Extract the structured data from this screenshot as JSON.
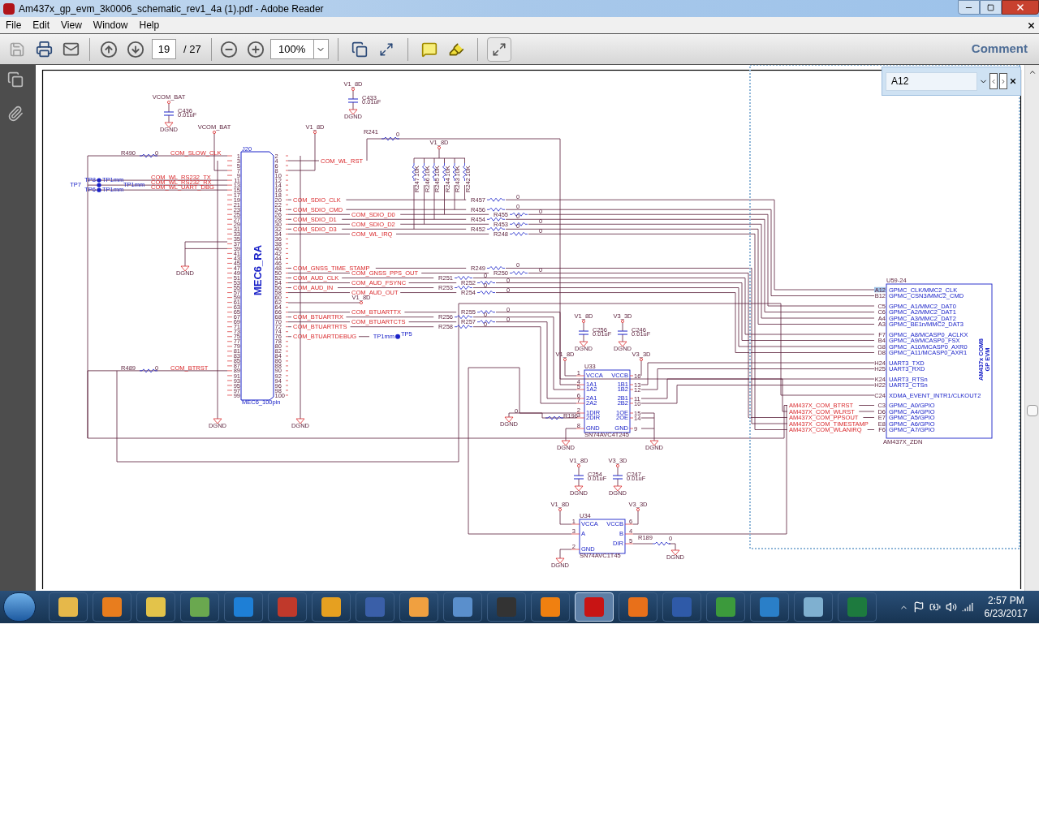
{
  "window": {
    "title": "Am437x_gp_evm_3k0006_schematic_rev1_4a (1).pdf - Adobe Reader"
  },
  "menu": [
    "File",
    "Edit",
    "View",
    "Window",
    "Help"
  ],
  "toolbar": {
    "page": "19",
    "page_total": "/ 27",
    "zoom": "100%",
    "comment": "Comment"
  },
  "find": {
    "value": "A12"
  },
  "schematic": {
    "j20": {
      "ref": "J20",
      "label": "MEC6_RA",
      "part": "MEC6_100pin",
      "left_pins": [
        {
          "num": "1",
          "net": "COM_SLOW_CLK",
          "resistor": "R490",
          "value": "0"
        },
        {
          "num": "3"
        },
        {
          "num": "5"
        },
        {
          "num": "7"
        },
        {
          "num": "9"
        },
        {
          "num": "11",
          "net": "COM_WL_RS232_TX",
          "testpoint": "TP8",
          "tp_type": "TP1mm"
        },
        {
          "num": "13",
          "net": "COM_WL_RS232_RX",
          "testpoint": "TP7",
          "tp_type": "TP1mm"
        },
        {
          "num": "15",
          "net": "COM_WL_UART_DBG",
          "testpoint": "TP6",
          "tp_type": "TP1mm"
        },
        {
          "num": "17"
        },
        {
          "num": "19"
        },
        {
          "num": "21"
        },
        {
          "num": "23"
        },
        {
          "num": "25"
        },
        {
          "num": "27"
        },
        {
          "num": "29"
        },
        {
          "num": "31"
        },
        {
          "num": "33"
        },
        {
          "num": "35"
        },
        {
          "num": "37"
        },
        {
          "num": "39"
        },
        {
          "num": "41"
        },
        {
          "num": "43"
        },
        {
          "num": "45"
        },
        {
          "num": "47"
        },
        {
          "num": "49"
        },
        {
          "num": "51"
        },
        {
          "num": "53"
        },
        {
          "num": "55"
        },
        {
          "num": "57"
        },
        {
          "num": "59"
        },
        {
          "num": "61"
        },
        {
          "num": "63"
        },
        {
          "num": "65"
        },
        {
          "num": "67"
        },
        {
          "num": "69"
        },
        {
          "num": "71"
        },
        {
          "num": "73"
        },
        {
          "num": "75"
        },
        {
          "num": "77"
        },
        {
          "num": "79"
        },
        {
          "num": "81"
        },
        {
          "num": "83"
        },
        {
          "num": "85"
        },
        {
          "num": "87"
        },
        {
          "num": "89",
          "net": "COM_BTRST",
          "resistor": "R489",
          "value": "0"
        },
        {
          "num": "91"
        },
        {
          "num": "93"
        },
        {
          "num": "95"
        },
        {
          "num": "97"
        },
        {
          "num": "99"
        }
      ],
      "right_pins": [
        {
          "num": "2"
        },
        {
          "num": "4",
          "net": "COM_WL_RST",
          "resistor": "R241",
          "value": "0"
        },
        {
          "num": "6"
        },
        {
          "num": "8"
        },
        {
          "num": "10"
        },
        {
          "num": "12"
        },
        {
          "num": "14"
        },
        {
          "num": "16"
        },
        {
          "num": "18"
        },
        {
          "num": "20",
          "net": "COM_SDIO_CLK",
          "resistor": "R457",
          "value": "0"
        },
        {
          "num": "22"
        },
        {
          "num": "24",
          "net": "COM_SDIO_CMD",
          "resistor": "R456",
          "value": "0"
        },
        {
          "num": "26",
          "net": "COM_SDIO_D0",
          "resistor": "R455",
          "value": "0"
        },
        {
          "num": "28",
          "net": "COM_SDIO_D1",
          "resistor": "R454",
          "value": "0"
        },
        {
          "num": "30",
          "net": "COM_SDIO_D2",
          "resistor": "R453",
          "value": "0"
        },
        {
          "num": "32",
          "net": "COM_SDIO_D3",
          "resistor": "R452",
          "value": "0"
        },
        {
          "num": "34",
          "net": "COM_WL_IRQ",
          "resistor": "R248",
          "value": "0"
        },
        {
          "num": "36"
        },
        {
          "num": "38"
        },
        {
          "num": "40"
        },
        {
          "num": "42"
        },
        {
          "num": "44"
        },
        {
          "num": "46"
        },
        {
          "num": "48",
          "net": "COM_GNSS_TIME_STAMP",
          "resistor": "R249",
          "value": "0"
        },
        {
          "num": "50",
          "net": "COM_GNSS_PPS_OUT",
          "resistor": "R250",
          "value": "0"
        },
        {
          "num": "52",
          "net": "COM_AUD_CLK",
          "resistor": "R251",
          "value": "0"
        },
        {
          "num": "54",
          "net": "COM_AUD_FSYNC",
          "resistor": "R252",
          "value": "0"
        },
        {
          "num": "56",
          "net": "COM_AUD_IN",
          "resistor": "R253",
          "value": "0"
        },
        {
          "num": "58",
          "net": "COM_AUD_OUT",
          "resistor": "R254",
          "value": "0"
        },
        {
          "num": "60"
        },
        {
          "num": "62"
        },
        {
          "num": "64"
        },
        {
          "num": "66",
          "net": "COM_BTUARTTX",
          "resistor": "R255",
          "value": "0"
        },
        {
          "num": "68",
          "net": "COM_BTUARTRX",
          "resistor": "R256",
          "value": "0"
        },
        {
          "num": "70",
          "net": "COM_BTUARTCTS",
          "resistor": "R257",
          "value": "0"
        },
        {
          "num": "72",
          "net": "COM_BTUARTRTS",
          "resistor": "R258",
          "value": "0"
        },
        {
          "num": "74"
        },
        {
          "num": "76",
          "net": "COM_BTUARTDEBUG",
          "testpoint": "TP5",
          "tp_type": "TP1mm"
        },
        {
          "num": "78"
        },
        {
          "num": "80"
        },
        {
          "num": "82"
        },
        {
          "num": "84"
        },
        {
          "num": "86"
        },
        {
          "num": "88"
        },
        {
          "num": "90"
        },
        {
          "num": "92"
        },
        {
          "num": "94"
        },
        {
          "num": "96"
        },
        {
          "num": "98"
        },
        {
          "num": "100"
        }
      ]
    },
    "pullups": [
      {
        "ref": "R247",
        "value": "10K"
      },
      {
        "ref": "R246",
        "value": "10K"
      },
      {
        "ref": "R245",
        "value": "10K"
      },
      {
        "ref": "R244",
        "value": "10K"
      },
      {
        "ref": "R243",
        "value": "10K"
      },
      {
        "ref": "R242",
        "value": "10K"
      }
    ],
    "capacitors": [
      {
        "ref": "C436",
        "value": "0.01uF",
        "rail": "VCOM_BAT",
        "ground": "DGND"
      },
      {
        "ref": "C433",
        "value": "0.01uF",
        "rail": "V1_8D",
        "ground": "DGND"
      },
      {
        "ref": "C256",
        "value": "0.01uF",
        "rail": "V1_8D",
        "ground": "DGND"
      },
      {
        "ref": "C246",
        "value": "0.01uF",
        "rail": "V3_3D",
        "ground": "DGND"
      },
      {
        "ref": "C254",
        "value": "0.01uF",
        "rail": "V1_8D",
        "ground": "DGND"
      },
      {
        "ref": "C247",
        "value": "0.01uF",
        "rail": "V3_3D",
        "ground": "DGND"
      }
    ],
    "power_flags": [
      "VCOM_BAT",
      "V1_8D",
      "V1_8D",
      "V1_8D",
      "V1_8D",
      "V3_3D",
      "V1_8D",
      "V3_3D"
    ],
    "ground_flags": [
      "DGND",
      "DGND",
      "DGND",
      "DGND",
      "DGND",
      "DGND",
      "DGND",
      "DGND"
    ],
    "u33": {
      "ref": "U33",
      "part": "SN74AVC4T245",
      "left": [
        {
          "num": "1",
          "name": "VCCA"
        },
        {
          "num": "4",
          "name": "1A1"
        },
        {
          "num": "5",
          "name": "1A2"
        },
        {
          "num": "6",
          "name": "2A1"
        },
        {
          "num": "7",
          "name": "2A2"
        },
        {
          "num": "2",
          "name": "1DIR"
        },
        {
          "num": "3",
          "name": "2DIR"
        },
        {
          "num": "8",
          "name": "GND"
        }
      ],
      "right": [
        {
          "num": "16",
          "name": "VCCB"
        },
        {
          "num": "13",
          "name": "1B1"
        },
        {
          "num": "12",
          "name": "1B2"
        },
        {
          "num": "11",
          "name": "2B1"
        },
        {
          "num": "10",
          "name": "2B2"
        },
        {
          "num": "15",
          "name": "1OE"
        },
        {
          "num": "14",
          "name": "2OE"
        },
        {
          "num": "9",
          "name": "GND"
        }
      ],
      "resistor": "R196",
      "value": "0"
    },
    "u34": {
      "ref": "U34",
      "part": "SN74AVC1T45",
      "left": [
        {
          "num": "1",
          "name": "VCCA"
        },
        {
          "num": "3",
          "name": "A"
        },
        {
          "num": "2",
          "name": "GND"
        }
      ],
      "right": [
        {
          "num": "6",
          "name": "VCCB"
        },
        {
          "num": "4",
          "name": "B"
        },
        {
          "num": "5",
          "name": "DIR"
        }
      ],
      "resistor": "R189",
      "value": "0"
    },
    "am437x": {
      "ref": "U59-24",
      "title": "AM437x COM8",
      "subtitle": "GP EVM",
      "part": "AM437X_ZDN",
      "groups": [
        [
          {
            "ball": "A12",
            "name": "GPMC_CLK/MMC2_CLK",
            "highlighted": true
          },
          {
            "ball": "B12",
            "name": "GPMC_CSN3/MMC2_CMD",
            "highlighted": false
          }
        ],
        [
          {
            "ball": "C5",
            "name": "GPMC_A1/MMC2_DAT0",
            "highlighted": false
          },
          {
            "ball": "C6",
            "name": "GPMC_A2/MMC2_DAT1",
            "highlighted": false
          },
          {
            "ball": "A4",
            "name": "GPMC_A3/MMC2_DAT2",
            "highlighted": false
          },
          {
            "ball": "A3",
            "name": "GPMC_BE1n/MMC2_DAT3",
            "highlighted": false
          }
        ],
        [
          {
            "ball": "F7",
            "name": "GPMC_A8/MCASP0_ACLKX",
            "highlighted": false
          },
          {
            "ball": "B4",
            "name": "GPMC_A9/MCASP0_FSX",
            "highlighted": false
          },
          {
            "ball": "G8",
            "name": "GPMC_A10/MCASP0_AXR0",
            "highlighted": false
          },
          {
            "ball": "D8",
            "name": "GPMC_A11/MCASP0_AXR1",
            "highlighted": false
          }
        ],
        [
          {
            "ball": "H24",
            "name": "UART3_TXD",
            "highlighted": false
          },
          {
            "ball": "H25",
            "name": "UART3_RXD",
            "highlighted": false
          }
        ],
        [
          {
            "ball": "K24",
            "name": "UART3_RTSn",
            "highlighted": false
          },
          {
            "ball": "H22",
            "name": "UART3_CTSn",
            "highlighted": false
          }
        ],
        [
          {
            "ball": "C24",
            "name": "XDMA_EVENT_INTR1/CLKOUT2",
            "highlighted": false
          }
        ],
        [
          {
            "ball": "C3",
            "name": "GPMC_A0/GPIO",
            "net": "AM437X_COM_BTRST",
            "highlighted": false
          },
          {
            "ball": "D6",
            "name": "GPMC_A4/GPIO",
            "net": "AM437X_COM_WLRST",
            "highlighted": false
          },
          {
            "ball": "E7",
            "name": "GPMC_A5/GPIO",
            "net": "AM437X_COM_PPSOUT",
            "highlighted": false
          },
          {
            "ball": "E8",
            "name": "GPMC_A6/GPIO",
            "net": "AM437X_COM_TIMESTAMP",
            "highlighted": false
          },
          {
            "ball": "F6",
            "name": "GPMC_A7/GPIO",
            "net": "AM437X_COM_WLANIRQ",
            "highlighted": false
          }
        ]
      ]
    }
  },
  "taskbar": {
    "apps": [
      {
        "active": false
      },
      {
        "active": false
      },
      {
        "active": false
      },
      {
        "active": false
      },
      {
        "active": false
      },
      {
        "active": false
      },
      {
        "active": false
      },
      {
        "active": false
      },
      {
        "active": false
      },
      {
        "active": false
      },
      {
        "active": false
      },
      {
        "active": false
      },
      {
        "active": true
      },
      {
        "active": false
      },
      {
        "active": false
      },
      {
        "active": false
      },
      {
        "active": false
      },
      {
        "active": false
      },
      {
        "active": false
      }
    ],
    "time": "2:57 PM",
    "date": "6/23/2017"
  }
}
